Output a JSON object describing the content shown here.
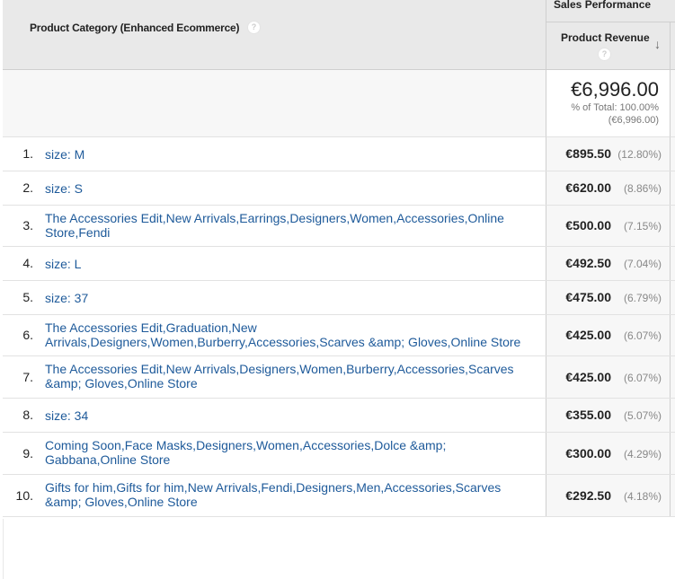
{
  "header": {
    "dimension_label": "Product Category (Enhanced Ecommerce)",
    "group_label": "Sales Performance",
    "metric_label": "Product Revenue",
    "help_icon": "?",
    "sort_icon": "↓"
  },
  "totals": {
    "value": "€6,996.00",
    "pct_line": "% of Total: 100.00%",
    "total_line": "(€6,996.00)"
  },
  "rows": [
    {
      "rank": "1.",
      "category": "size: M",
      "revenue": "€895.50",
      "share": "(12.80%)"
    },
    {
      "rank": "2.",
      "category": "size: S",
      "revenue": "€620.00",
      "share": "(8.86%)"
    },
    {
      "rank": "3.",
      "category": "The Accessories Edit,New Arrivals,Earrings,Designers,Women,Accessories,Online Store,Fendi",
      "revenue": "€500.00",
      "share": "(7.15%)"
    },
    {
      "rank": "4.",
      "category": "size: L",
      "revenue": "€492.50",
      "share": "(7.04%)"
    },
    {
      "rank": "5.",
      "category": "size: 37",
      "revenue": "€475.00",
      "share": "(6.79%)"
    },
    {
      "rank": "6.",
      "category": "The Accessories Edit,Graduation,New Arrivals,Designers,Women,Burberry,Accessories,Scarves &amp; Gloves,Online Store",
      "revenue": "€425.00",
      "share": "(6.07%)"
    },
    {
      "rank": "7.",
      "category": "The Accessories Edit,New Arrivals,Designers,Women,Burberry,Accessories,Scarves &amp; Gloves,Online Store",
      "revenue": "€425.00",
      "share": "(6.07%)"
    },
    {
      "rank": "8.",
      "category": "size: 34",
      "revenue": "€355.00",
      "share": "(5.07%)"
    },
    {
      "rank": "9.",
      "category": "Coming Soon,Face Masks,Designers,Women,Accessories,Dolce &amp; Gabbana,Online Store",
      "revenue": "€300.00",
      "share": "(4.29%)"
    },
    {
      "rank": "10.",
      "category": "Gifts for him,Gifts for him,New Arrivals,Fendi,Designers,Men,Accessories,Scarves &amp; Gloves,Online Store",
      "revenue": "€292.50",
      "share": "(4.18%)"
    }
  ]
}
